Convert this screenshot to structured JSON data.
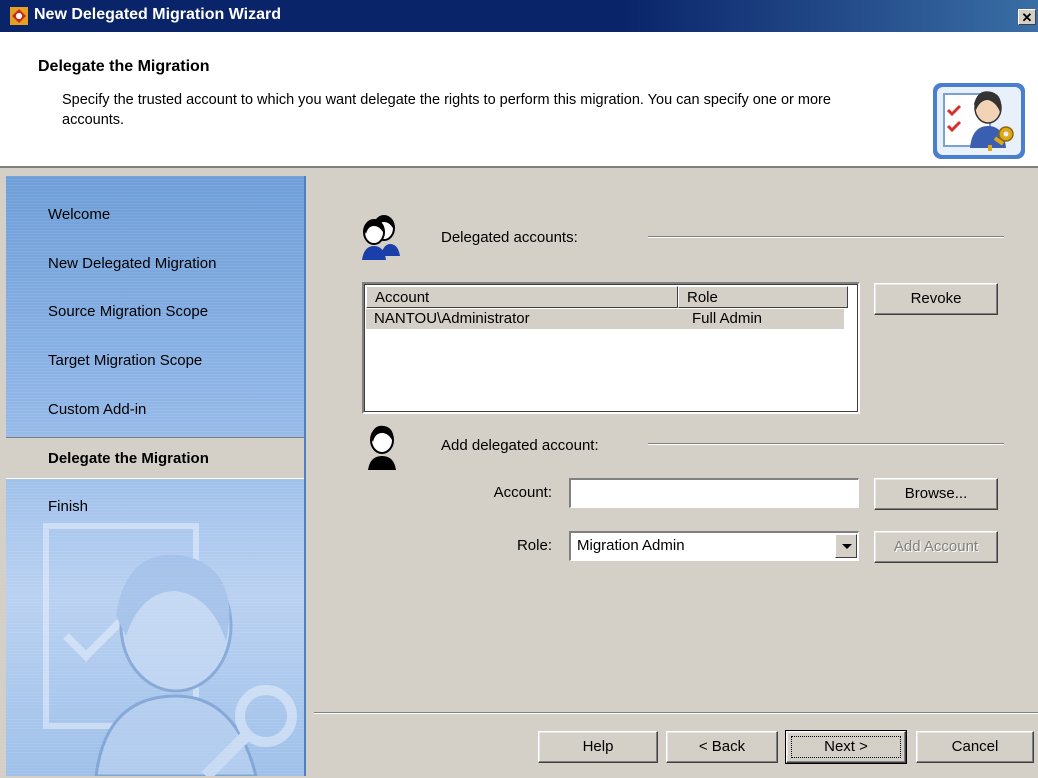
{
  "window": {
    "title": "New Delegated Migration Wizard",
    "close_glyph": "✕"
  },
  "header": {
    "title": "Delegate the Migration",
    "description": "Specify the trusted account to which you want delegate the rights to perform this migration. You can specify one or more accounts.",
    "icon": "user-key-icon"
  },
  "sidebar": {
    "items": [
      {
        "label": "Welcome",
        "active": false
      },
      {
        "label": "New Delegated Migration",
        "active": false
      },
      {
        "label": "Source Migration Scope",
        "active": false
      },
      {
        "label": "Target Migration Scope",
        "active": false
      },
      {
        "label": "Custom Add-in",
        "active": false
      },
      {
        "label": "Delegate the Migration",
        "active": true
      },
      {
        "label": "Finish",
        "active": false
      }
    ]
  },
  "delegated": {
    "section_label": "Delegated accounts:",
    "columns": [
      "Account",
      "Role"
    ],
    "rows": [
      {
        "account": "NANTOU\\Administrator",
        "role": "Full Admin"
      }
    ],
    "revoke_label": "Revoke"
  },
  "add": {
    "section_label": "Add delegated account:",
    "account_label": "Account:",
    "account_value": "",
    "browse_label": "Browse...",
    "role_label": "Role:",
    "role_value": "Migration Admin",
    "add_account_label": "Add Account"
  },
  "footer": {
    "help_label": "Help",
    "back_label": "< Back",
    "next_label": "Next >",
    "cancel_label": "Cancel"
  }
}
